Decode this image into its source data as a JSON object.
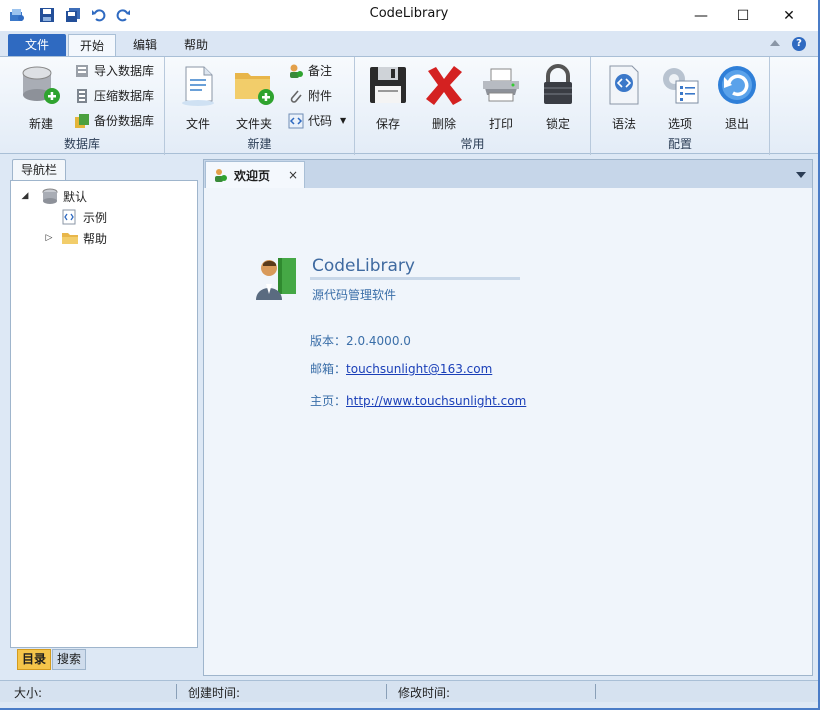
{
  "window": {
    "title": "CodeLibrary",
    "controls": {
      "minimize": "—",
      "maximize": "☐",
      "close": "✕"
    }
  },
  "ribbon": {
    "tabs": {
      "file": "文件",
      "home": "开始",
      "edit": "编辑",
      "help": "帮助"
    },
    "groups": {
      "database": {
        "label": "数据库",
        "new": "新建",
        "import": "导入数据库",
        "compress": "压缩数据库",
        "backup": "备份数据库"
      },
      "create": {
        "label": "新建",
        "file": "文件",
        "folder": "文件夹",
        "note": "备注",
        "attachment": "附件",
        "code": "代码"
      },
      "common": {
        "label": "常用",
        "save": "保存",
        "delete": "删除",
        "print": "打印",
        "lock": "锁定"
      },
      "config": {
        "label": "配置",
        "syntax": "语法",
        "options": "选项",
        "exit": "退出"
      }
    }
  },
  "nav": {
    "title": "导航栏",
    "tree": [
      {
        "label": "默认",
        "expanded": true
      },
      {
        "label": "示例"
      },
      {
        "label": "帮助",
        "expanded": false
      }
    ],
    "bottom_tabs": {
      "catalog": "目录",
      "search": "搜索"
    }
  },
  "doc": {
    "tab_label": "欢迎页",
    "close": "×",
    "welcome": {
      "title": "CodeLibrary",
      "subtitle": "源代码管理软件",
      "version_label": "版本：",
      "version": "2.0.4000.0",
      "email_label": "邮箱：",
      "email": "touchsunlight@163.com",
      "home_label": "主页：",
      "home": "http://www.touchsunlight.com"
    }
  },
  "status": {
    "size": "大小:",
    "created": "创建时间:",
    "modified": "修改时间:"
  }
}
